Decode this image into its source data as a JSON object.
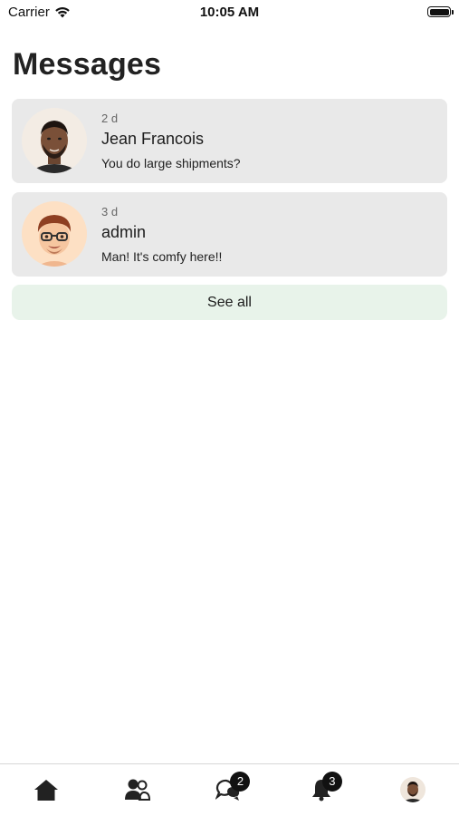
{
  "status_bar": {
    "carrier": "Carrier",
    "time": "10:05 AM"
  },
  "page": {
    "title": "Messages"
  },
  "messages": [
    {
      "time_ago": "2 d",
      "name": "Jean Francois",
      "preview": "You do large shipments?",
      "avatar_icon": "person-photo-avatar"
    },
    {
      "time_ago": "3 d",
      "name": "admin",
      "preview": "Man! It's comfy here!!",
      "avatar_icon": "memoji-avatar"
    }
  ],
  "see_all_label": "See all",
  "tab_bar": {
    "items": [
      {
        "icon": "home-icon",
        "badge": ""
      },
      {
        "icon": "people-icon",
        "badge": ""
      },
      {
        "icon": "chat-icon",
        "badge": "2"
      },
      {
        "icon": "bell-icon",
        "badge": "3"
      },
      {
        "icon": "profile-avatar",
        "badge": ""
      }
    ]
  },
  "colors": {
    "card_bg": "#e9e9e9",
    "see_all_bg": "#e8f3ea",
    "badge_bg": "#111111"
  }
}
